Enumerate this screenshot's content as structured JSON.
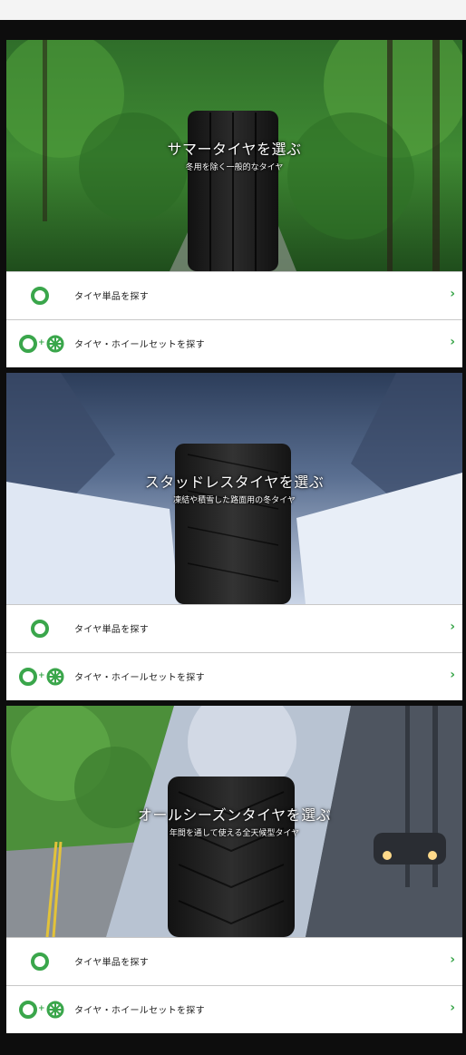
{
  "sections": [
    {
      "title": "サマータイヤを選ぶ",
      "subtitle": "冬用を除く一般的なタイヤ",
      "options": [
        {
          "label": "タイヤ単品を探す",
          "icon": "tire-icon"
        },
        {
          "label": "タイヤ・ホイールセットを探す",
          "icon": "tire-wheel-set-icon"
        }
      ]
    },
    {
      "title": "スタッドレスタイヤを選ぶ",
      "subtitle": "凍結や積雪した路面用の冬タイヤ",
      "options": [
        {
          "label": "タイヤ単品を探す",
          "icon": "tire-icon"
        },
        {
          "label": "タイヤ・ホイールセットを探す",
          "icon": "tire-wheel-set-icon"
        }
      ]
    },
    {
      "title": "オールシーズンタイヤを選ぶ",
      "subtitle": "年間を通して使える全天候型タイヤ",
      "options": [
        {
          "label": "タイヤ単品を探す",
          "icon": "tire-icon"
        },
        {
          "label": "タイヤ・ホイールセットを探す",
          "icon": "tire-wheel-set-icon"
        }
      ]
    }
  ],
  "colors": {
    "accent": "#3aa64b",
    "background": "#0d0d0d",
    "topbar": "#f4f4f4"
  }
}
